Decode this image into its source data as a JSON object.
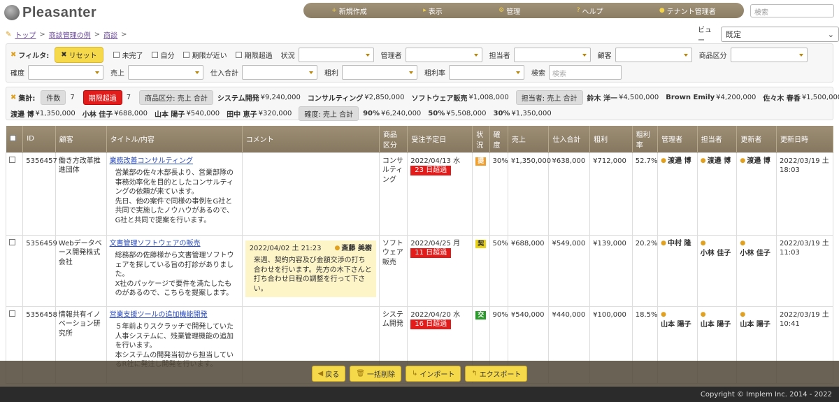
{
  "app": {
    "name": "Pleasanter"
  },
  "nav": [
    {
      "icon": "plus-icon",
      "label": "新規作成"
    },
    {
      "icon": "arrow-icon",
      "label": "表示"
    },
    {
      "icon": "gear-icon",
      "label": "管理"
    },
    {
      "icon": "help-icon",
      "label": "ヘルプ"
    },
    {
      "icon": "user-icon",
      "label": "テナント管理者"
    }
  ],
  "search": {
    "placeholder": "検索"
  },
  "breadcrumb": [
    "トップ",
    "商談管理の例",
    "商談"
  ],
  "view": {
    "label": "ビュー",
    "value": "既定"
  },
  "filter": {
    "label": "フィルタ:",
    "reset": "リセット",
    "checks": [
      "未完了",
      "自分",
      "期限が近い",
      "期限超過"
    ],
    "row1": [
      "状況",
      "管理者",
      "担当者",
      "顧客",
      "商品区分"
    ],
    "row2": [
      "確度",
      "売上",
      "仕入合計",
      "粗利",
      "粗利率"
    ],
    "search_label": "検索",
    "search_placeholder": "検索"
  },
  "summary": {
    "label": "集計:",
    "count_label": "件数",
    "count_value": "7",
    "overdue_label": "期限超過",
    "overdue_value": "7",
    "cat_chip": "商品区分: 売上 合計",
    "cat_items": [
      {
        "name": "システム開発",
        "value": "¥9,240,000"
      },
      {
        "name": "コンサルティング",
        "value": "¥2,850,000"
      },
      {
        "name": "ソフトウェア販売",
        "value": "¥1,008,000"
      }
    ],
    "owner_chip": "担当者: 売上 合計",
    "owner_items_row1": [
      {
        "name": "鈴木 洋一",
        "value": "¥4,500,000"
      },
      {
        "name": "Brown Emily",
        "value": "¥4,200,000"
      },
      {
        "name": "佐々木 春香",
        "value": "¥1,500,000"
      }
    ],
    "owner_items_row2": [
      {
        "name": "渡邉 博",
        "value": "¥1,350,000"
      },
      {
        "name": "小林 佳子",
        "value": "¥688,000"
      },
      {
        "name": "山本 陽子",
        "value": "¥540,000"
      },
      {
        "name": "田中 恵子",
        "value": "¥320,000"
      }
    ],
    "prob_chip": "確度: 売上 合計",
    "prob_items": [
      {
        "name": "90%",
        "value": "¥6,240,000"
      },
      {
        "name": "50%",
        "value": "¥5,508,000"
      },
      {
        "name": "30%",
        "value": "¥1,350,000"
      }
    ]
  },
  "table": {
    "headers": [
      "ID",
      "顧客",
      "タイトル/内容",
      "コメント",
      "商品区分",
      "受注予定日",
      "状況",
      "確度",
      "売上",
      "仕入合計",
      "粗利",
      "粗利率",
      "管理者",
      "担当者",
      "更新者",
      "更新日時"
    ],
    "rows": [
      {
        "id": "5356457",
        "customer": "働き方改革推進団体",
        "title": "業務改善コンサルティング",
        "desc": "営業部の佐々木部長より、営業部隊の事務効率化を目的としたコンサルティングの依頼が来ています。\n先日、他の案件で同様の事例をG社と共同で実施したノウハウがあるので、G社と共同で提案を行います。",
        "comment": null,
        "category": "コンサルティング",
        "due": "2022/04/13 水",
        "overdue": "23 日超過",
        "status": "提",
        "status_color": "#f0a030",
        "prob": "30%",
        "sales": "¥1,350,000",
        "cost": "¥638,000",
        "profit": "¥712,000",
        "margin": "52.7%",
        "manager": "渡邉 博",
        "owner": "渡邉 博",
        "updater": "渡邉 博",
        "updated": "2022/03/19 土 18:03"
      },
      {
        "id": "5356459",
        "customer": "Webデータベース開発株式会社",
        "title": "文書管理ソフトウェアの販売",
        "desc": "総務部の佐藤様から文書管理ソフトウェアを探している旨の打診がありました。\nX社のパッケージで要件を満たしたものがあるので、こちらを提案します。",
        "comment": {
          "time": "2022/04/02 土 21:23",
          "author": "斎藤 美樹",
          "text": "来週、契約内容及び金額交渉の打ち合わせを行います。先方の木下さんと打ち合わせ日程の調整を行って下さい。"
        },
        "category": "ソフトウェア販売",
        "due": "2022/04/25 月",
        "overdue": "11 日超過",
        "status": "契",
        "status_color": "#e8d21a",
        "prob": "50%",
        "sales": "¥688,000",
        "cost": "¥549,000",
        "profit": "¥139,000",
        "margin": "20.2%",
        "manager": "中村 隆",
        "owner": "小林 佳子",
        "updater": "小林 佳子",
        "updated": "2022/03/19 土 11:03"
      },
      {
        "id": "5356458",
        "customer": "情報共有イノベーション研究所",
        "title": "営業支援ツールの追加機能開発",
        "desc": "５年前よりスクラッチで開発していた人事システムに、残業管理機能の追加を行います。\n本システムの開発当初から担当しているR社に発注し開発を行います。",
        "comment": null,
        "category": "システム開発",
        "due": "2022/04/20 水",
        "overdue": "16 日超過",
        "status": "交",
        "status_color": "#2a9a2a",
        "prob": "90%",
        "sales": "¥540,000",
        "cost": "¥440,000",
        "profit": "¥100,000",
        "margin": "18.5%",
        "manager": "山本 陽子",
        "owner": "山本 陽子",
        "updater": "山本 陽子",
        "updated": "2022/03/19 土 10:41"
      }
    ]
  },
  "actions": [
    {
      "icon": "back-icon",
      "label": "戻る"
    },
    {
      "icon": "trash-icon",
      "label": "一括削除"
    },
    {
      "icon": "import-icon",
      "label": "インポート"
    },
    {
      "icon": "export-icon",
      "label": "エクスポート"
    }
  ],
  "footer": {
    "copyright": "Copyright © Implem Inc. 2014 - 2022"
  }
}
